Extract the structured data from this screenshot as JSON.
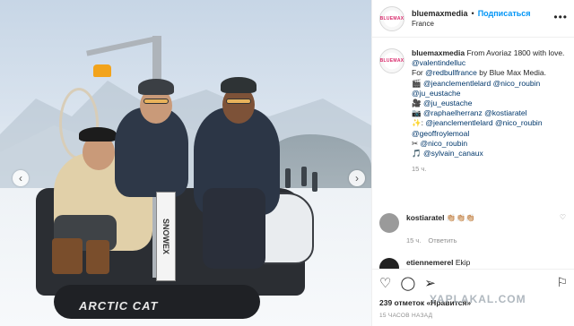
{
  "photo": {
    "snowmobile_brand": "ARCTIC CAT",
    "sign_text": "SNOWEX",
    "nav_left": "‹",
    "nav_right": "›"
  },
  "header": {
    "username": "bluemaxmedia",
    "separator": "•",
    "follow_label": "Подписаться",
    "location": "France",
    "more": "•••",
    "avatar_logo": "BLUEMAX"
  },
  "caption": {
    "username": "bluemaxmedia",
    "lines": [
      "From Avoriaz 1800 with love.",
      "@valentindelluc",
      "For",
      "@redbullfrance",
      "by Blue Max Media.",
      "🎬",
      "@jeanclementlelard",
      "@nico_roubin",
      "@ju_eustache",
      "🎥",
      "@ju_eustache",
      "📷",
      "@raphaelherranz",
      "@kostiaratel",
      "✨:",
      "@jeanclementlelard",
      "@nico_roubin",
      "@geoffroylemoal",
      "✂",
      "@nico_roubin",
      "🎵",
      "@sylvain_canaux"
    ],
    "time": "15 ч."
  },
  "comments": [
    {
      "username": "kostiaratel",
      "text": "👏🏼👏🏼👏🏼",
      "time": "15 ч.",
      "reply": "Ответить"
    },
    {
      "username": "etiennemerel",
      "text": "Ekip"
    }
  ],
  "actions": {
    "like_icon": "heart-icon",
    "comment_icon": "comment-icon",
    "share_icon": "share-icon",
    "save_icon": "bookmark-icon",
    "likes_text": "239 отметок «Нравится»",
    "post_time": "15 ЧАСОВ НАЗАД",
    "watermark": "YAPLAKAL.COM"
  },
  "colors": {
    "follow": "#0095f6",
    "link": "#00376b",
    "muted": "#8e8e8e"
  }
}
